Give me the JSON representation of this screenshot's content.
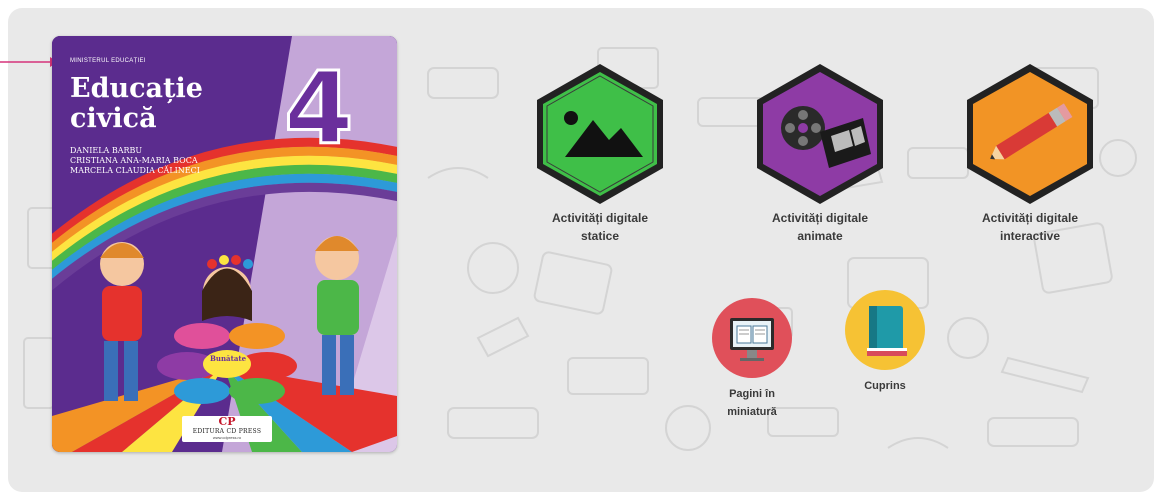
{
  "book": {
    "ministry": "MINISTERUL EDUCAȚIEI",
    "title_line1": "Educație",
    "title_line2": "civică",
    "grade": "4",
    "authors": [
      "DANIELA BARBU",
      "CRISTIANA ANA-MARIA BOCA",
      "MARCELA CLAUDIA CĂLINECI"
    ],
    "publisher_logo": "CP",
    "publisher_name": "EDITURA CD PRESS",
    "publisher_url": "www.cdpress.ro",
    "flower_center": "Bunătate"
  },
  "activities": [
    {
      "line1": "Activități digitale",
      "line2": "statice",
      "icon": "mountain-image-icon",
      "color": "#3fbf48"
    },
    {
      "line1": "Activități digitale",
      "line2": "animate",
      "icon": "film-reel-icon",
      "color": "#8e3ba5"
    },
    {
      "line1": "Activități digitale",
      "line2": "interactive",
      "icon": "pencil-icon",
      "color": "#f29425"
    }
  ],
  "tools": [
    {
      "line1": "Pagini în",
      "line2": "miniatură",
      "icon": "monitor-book-icon",
      "color": "#e0505a"
    },
    {
      "line1": "Cuprins",
      "line2": "",
      "icon": "book-stack-icon",
      "color": "#f6c234"
    }
  ]
}
